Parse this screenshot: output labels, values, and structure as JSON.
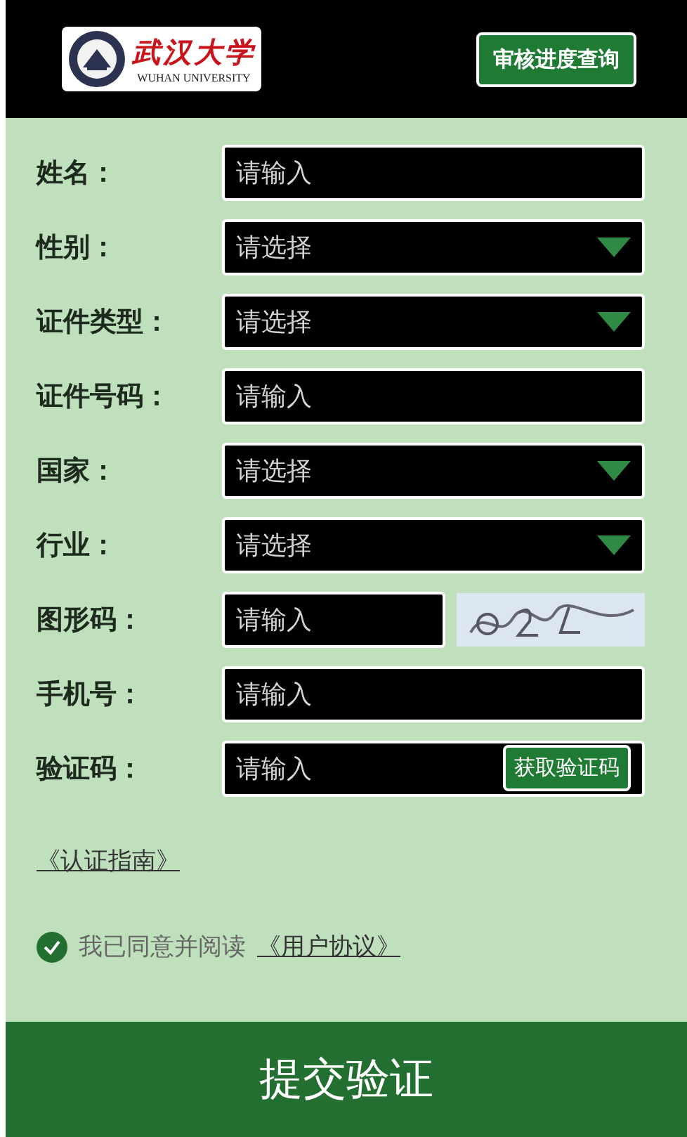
{
  "header": {
    "logo": {
      "name": "武汉大学",
      "subtitle": "WUHAN UNIVERSITY"
    },
    "query_button": "审核进度查询"
  },
  "fields": [
    {
      "label": "姓名：",
      "kind": "input",
      "placeholder": "请输入"
    },
    {
      "label": "性别：",
      "kind": "select",
      "placeholder": "请选择"
    },
    {
      "label": "证件类型：",
      "kind": "select",
      "placeholder": "请选择"
    },
    {
      "label": "证件号码：",
      "kind": "input",
      "placeholder": "请输入"
    },
    {
      "label": "国家：",
      "kind": "select",
      "placeholder": "请选择"
    },
    {
      "label": "行业：",
      "kind": "select",
      "placeholder": "请选择"
    },
    {
      "label": "图形码：",
      "kind": "captcha",
      "placeholder": "请输入"
    },
    {
      "label": "手机号：",
      "kind": "input",
      "placeholder": "请输入"
    },
    {
      "label": "验证码：",
      "kind": "sms",
      "placeholder": "请输入",
      "button": "获取验证码"
    }
  ],
  "guide_link": "《认证指南》",
  "agreement": {
    "checked": true,
    "text": "我已同意并阅读",
    "link": "《用户协议》"
  },
  "submit_button": "提交验证"
}
